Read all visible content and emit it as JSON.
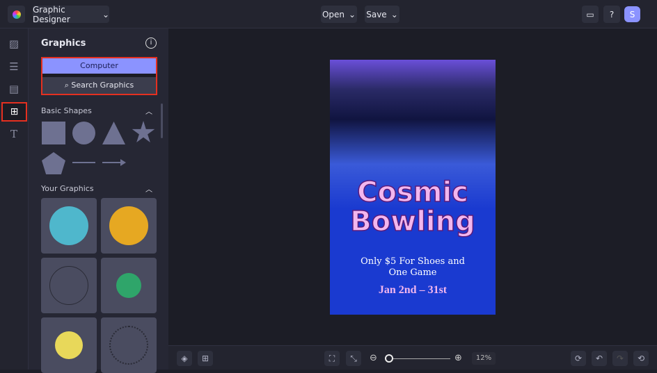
{
  "header": {
    "app_menu": "Graphic Designer",
    "open": "Open",
    "save": "Save",
    "avatar": "S"
  },
  "panel": {
    "title": "Graphics",
    "computer": "Computer",
    "search": "Search Graphics",
    "basic_shapes": "Basic Shapes",
    "your_graphics": "Your Graphics"
  },
  "poster": {
    "title1": "Cosmic",
    "title2": "Bowling",
    "line1": "Only $5 For Shoes and",
    "line2": "One Game",
    "dates": "Jan 2nd – 31st"
  },
  "footer": {
    "zoom": "12%",
    "zoom_fraction": 0.02
  },
  "colors": {
    "accent": "#8b93ff",
    "highlight": "#e53020",
    "poster_blue": "#1a3ad0",
    "title_pink": "#f2b6ee"
  }
}
